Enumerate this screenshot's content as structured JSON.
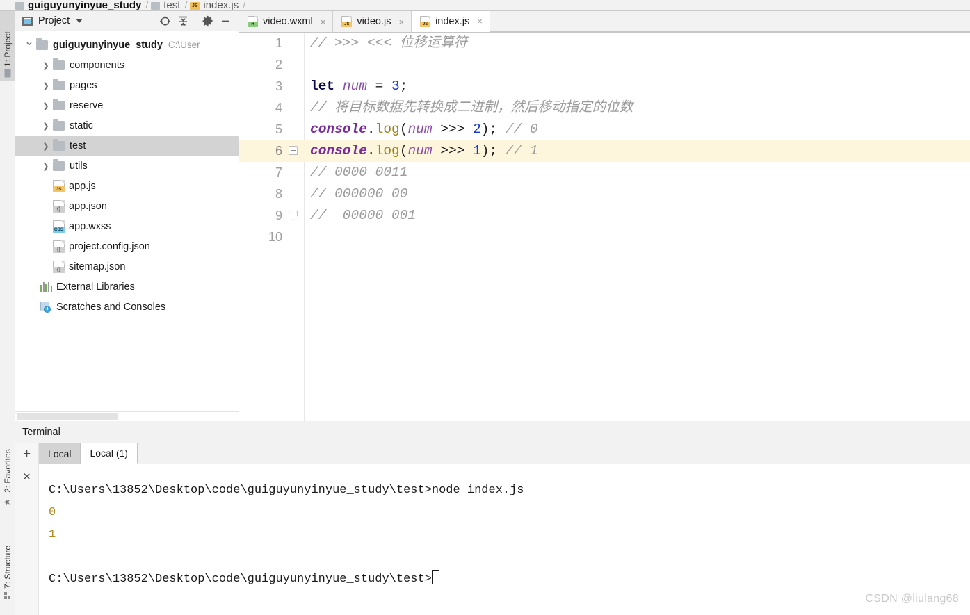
{
  "breadcrumb": {
    "items": [
      {
        "label": "guiguyunyinyue_study",
        "icon": "folder-icon",
        "bold": true
      },
      {
        "label": "test",
        "icon": "folder-icon",
        "bold": false
      },
      {
        "label": "index.js",
        "icon": "js-file-icon",
        "bold": false
      }
    ],
    "separator": "/"
  },
  "tool_strip": {
    "project_tab": "1: Project",
    "favorites_tab": "2: Favorites",
    "structure_tab": "7: Structure"
  },
  "project_panel": {
    "title": "Project",
    "toolbar": {
      "locate_icon": "target-icon",
      "collapse_icon": "collapse-all-icon",
      "settings_icon": "gear-icon",
      "hide_icon": "minimize-icon"
    },
    "tree": [
      {
        "label": "guiguyunyinyue_study",
        "path": "C:\\User",
        "type": "root",
        "arrow": "down",
        "bold": true,
        "indent": 0,
        "selected": false
      },
      {
        "label": "components",
        "type": "folder",
        "arrow": "right",
        "indent": 1,
        "selected": false
      },
      {
        "label": "pages",
        "type": "folder",
        "arrow": "right",
        "indent": 1,
        "selected": false
      },
      {
        "label": "reserve",
        "type": "folder",
        "arrow": "right",
        "indent": 1,
        "selected": false
      },
      {
        "label": "static",
        "type": "folder",
        "arrow": "right",
        "indent": 1,
        "selected": false
      },
      {
        "label": "test",
        "type": "folder",
        "arrow": "right",
        "indent": 1,
        "selected": true
      },
      {
        "label": "utils",
        "type": "folder",
        "arrow": "right",
        "indent": 1,
        "selected": false
      },
      {
        "label": "app.js",
        "type": "js",
        "badge": "JS",
        "arrow": "none",
        "indent": 1,
        "selected": false
      },
      {
        "label": "app.json",
        "type": "json",
        "badge": "{}",
        "arrow": "none",
        "indent": 1,
        "selected": false
      },
      {
        "label": "app.wxss",
        "type": "css",
        "badge": "CSS",
        "arrow": "none",
        "indent": 1,
        "selected": false
      },
      {
        "label": "project.config.json",
        "type": "json",
        "badge": "{}",
        "arrow": "none",
        "indent": 1,
        "selected": false
      },
      {
        "label": "sitemap.json",
        "type": "json",
        "badge": "{}",
        "arrow": "none",
        "indent": 1,
        "selected": false
      },
      {
        "label": "External Libraries",
        "type": "library",
        "arrow": "none",
        "indent": 0,
        "selected": false
      },
      {
        "label": "Scratches and Consoles",
        "type": "scratch",
        "arrow": "none",
        "indent": 0,
        "selected": false
      }
    ]
  },
  "editor": {
    "tabs": [
      {
        "label": "video.wxml",
        "badge": "H",
        "badge_kind": "h",
        "active": false,
        "close": "×"
      },
      {
        "label": "video.js",
        "badge": "JS",
        "badge_kind": "js",
        "active": false,
        "close": "×"
      },
      {
        "label": "index.js",
        "badge": "JS",
        "badge_kind": "js",
        "active": true,
        "close": "×"
      }
    ],
    "highlight_line": 6,
    "lines": [
      {
        "n": "1",
        "fold": "none",
        "tokens": [
          {
            "t": "// >>> <<< 位移运算符",
            "c": "comment"
          }
        ]
      },
      {
        "n": "2",
        "fold": "none",
        "tokens": []
      },
      {
        "n": "3",
        "fold": "none",
        "tokens": [
          {
            "t": "let",
            "c": "kw"
          },
          {
            "t": " ",
            "c": "plain"
          },
          {
            "t": "num",
            "c": "var"
          },
          {
            "t": " ",
            "c": "plain"
          },
          {
            "t": "=",
            "c": "op"
          },
          {
            "t": " ",
            "c": "plain"
          },
          {
            "t": "3",
            "c": "num"
          },
          {
            "t": ";",
            "c": "plain"
          }
        ]
      },
      {
        "n": "4",
        "fold": "none",
        "tokens": [
          {
            "t": "// 将目标数据先转换成二进制，然后移动指定的位数",
            "c": "comment"
          }
        ]
      },
      {
        "n": "5",
        "fold": "none",
        "tokens": [
          {
            "t": "console",
            "c": "obj"
          },
          {
            "t": ".",
            "c": "plain"
          },
          {
            "t": "log",
            "c": "fn"
          },
          {
            "t": "(",
            "c": "plain"
          },
          {
            "t": "num",
            "c": "var"
          },
          {
            "t": " >>> ",
            "c": "plain"
          },
          {
            "t": "2",
            "c": "num"
          },
          {
            "t": "); ",
            "c": "plain"
          },
          {
            "t": "// 0",
            "c": "comment"
          }
        ]
      },
      {
        "n": "6",
        "fold": "minus",
        "tokens": [
          {
            "t": "console",
            "c": "obj"
          },
          {
            "t": ".",
            "c": "plain"
          },
          {
            "t": "log",
            "c": "fn"
          },
          {
            "t": "(",
            "c": "plain"
          },
          {
            "t": "num",
            "c": "var"
          },
          {
            "t": " >>> ",
            "c": "plain"
          },
          {
            "t": "1",
            "c": "num"
          },
          {
            "t": "); ",
            "c": "plain"
          },
          {
            "t": "// 1",
            "c": "comment"
          }
        ]
      },
      {
        "n": "7",
        "fold": "line",
        "tokens": [
          {
            "t": "// 0000 0011",
            "c": "comment"
          }
        ]
      },
      {
        "n": "8",
        "fold": "line",
        "tokens": [
          {
            "t": "// 000000 00",
            "c": "comment"
          }
        ]
      },
      {
        "n": "9",
        "fold": "end",
        "tokens": [
          {
            "t": "//  00000 001",
            "c": "comment"
          }
        ]
      },
      {
        "n": "10",
        "fold": "none",
        "tokens": []
      }
    ]
  },
  "terminal": {
    "title": "Terminal",
    "add_button": "+",
    "close_button": "×",
    "tabs": [
      {
        "label": "Local",
        "active": false
      },
      {
        "label": "Local (1)",
        "active": true
      }
    ],
    "console_lines": [
      {
        "text": "C:\\Users\\13852\\Desktop\\code\\guiguyunyinyue_study\\test>node index.js",
        "kind": "prompt"
      },
      {
        "text": "0",
        "kind": "output"
      },
      {
        "text": "1",
        "kind": "output"
      },
      {
        "text": "",
        "kind": "blank"
      },
      {
        "text": "C:\\Users\\13852\\Desktop\\code\\guiguyunyinyue_study\\test>",
        "kind": "prompt-caret"
      }
    ]
  },
  "watermark": "CSDN @liulang68",
  "colors": {
    "selection": "#d3d3d3",
    "line_highlight": "#fdf6dd",
    "click_halo": "#fbdfab",
    "keyword": "#0a0a44",
    "variable": "#8b4fa8",
    "number": "#1538c9",
    "object": "#7a2a9c",
    "function": "#9a8418",
    "comment": "#9c9c9c"
  }
}
